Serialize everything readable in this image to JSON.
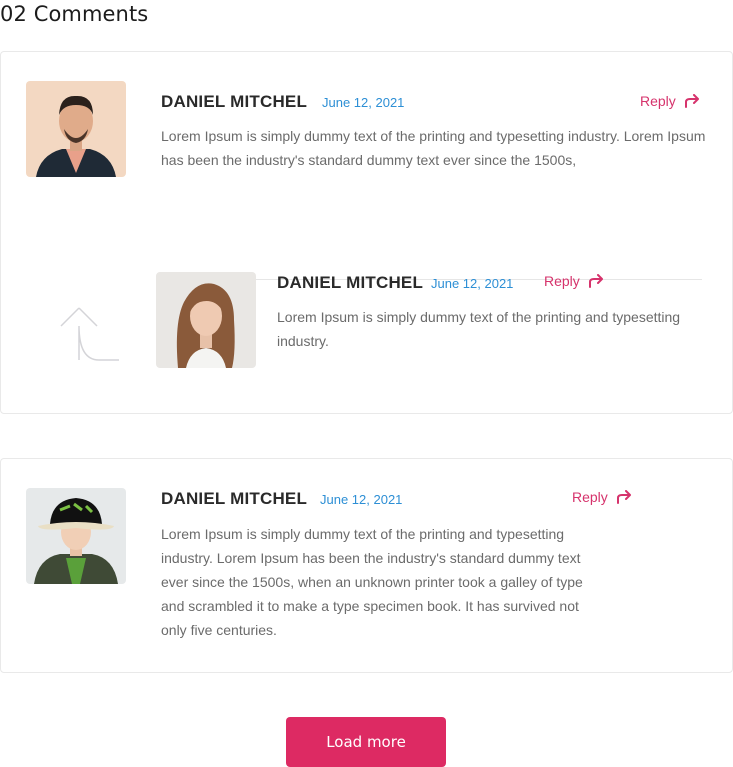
{
  "heading": "02 Comments",
  "comments": [
    {
      "author": "DANIEL MITCHEL",
      "date": "June 12, 2021",
      "reply_label": "Reply",
      "text": "Lorem Ipsum is simply dummy text of the printing and typesetting industry. Lorem Ipsum has been the industry's standard dummy text ever since the 1500s,"
    },
    {
      "author": "DANIEL MITCHEL",
      "date": "June 12, 2021",
      "reply_label": "Reply",
      "text": "Lorem Ipsum is simply dummy text of the printing and typesetting industry."
    },
    {
      "author": "DANIEL MITCHEL",
      "date": "June 12, 2021",
      "reply_label": "Reply",
      "text": "Lorem Ipsum is simply dummy text of the printing and typesetting industry. Lorem Ipsum has been the industry's standard dummy text ever since the 1500s, when an unknown printer took a galley of type and scrambled it to make a type specimen book. It has survived not only five centuries."
    }
  ],
  "load_more_label": "Load more",
  "colors": {
    "accent": "#dd2a63",
    "date": "#2d8fd5",
    "reply": "#d6336c"
  },
  "icons": {
    "reply": "reply-arrow-icon",
    "nested": "nested-reply-arrow-icon"
  }
}
